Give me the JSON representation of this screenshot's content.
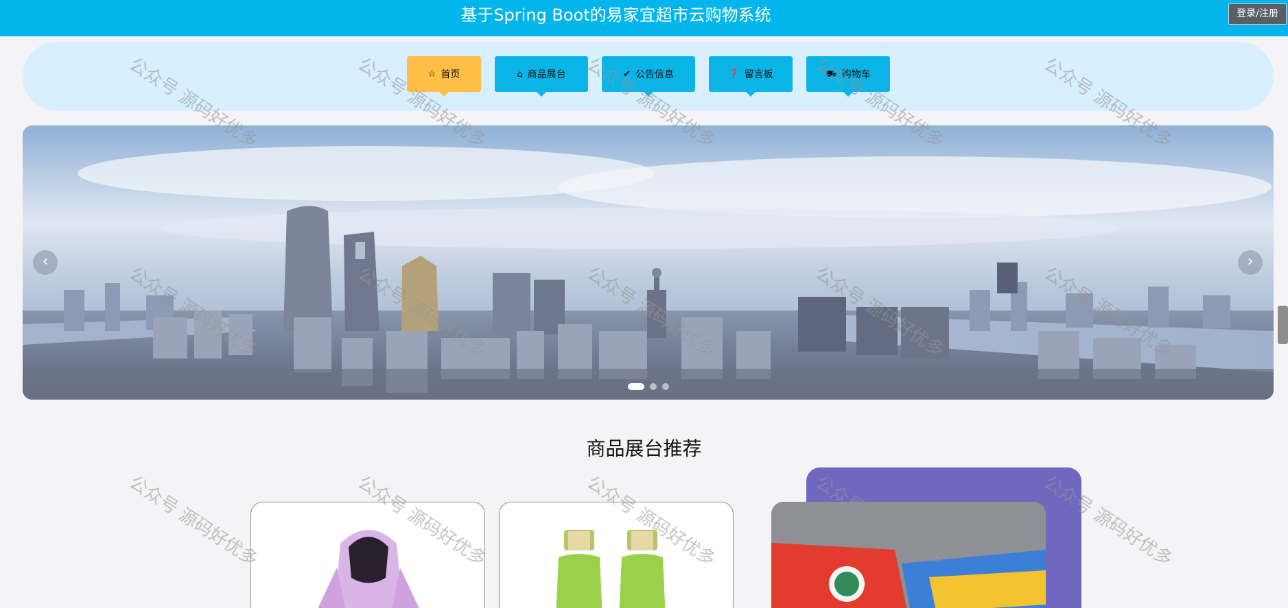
{
  "header": {
    "title": "基于Spring Boot的易家宜超市云购物系统",
    "login_label": "登录/注册"
  },
  "nav": {
    "items": [
      {
        "label": "首页",
        "icon": "star-icon",
        "glyph": "☆",
        "active": true
      },
      {
        "label": "商品展台",
        "icon": "shopping-bag-icon",
        "glyph": "⌂",
        "active": false
      },
      {
        "label": "公告信息",
        "icon": "bell-icon",
        "glyph": "✔",
        "active": false
      },
      {
        "label": "留言板",
        "icon": "question-icon",
        "glyph": "❓",
        "active": false
      },
      {
        "label": "购物车",
        "icon": "cart-icon",
        "glyph": "⛟",
        "active": false
      }
    ]
  },
  "carousel": {
    "prev_glyph": "‹",
    "next_glyph": "›",
    "dot_count": 3,
    "active_dot": 0
  },
  "section": {
    "title": "商品展台推荐"
  },
  "products": [
    {
      "image": "pink-hooded-jacket"
    },
    {
      "image": "green-cosmetic-bottles"
    },
    {
      "image": "snack-packets",
      "featured": true
    }
  ],
  "watermark": {
    "text": "公众号 源码好优多"
  },
  "colors": {
    "header_bg": "#02b5ea",
    "nav_bg": "#d7efff",
    "nav_item": "#0ab4e6",
    "nav_active": "#ffbe45",
    "feature_bg": "#7068bf"
  }
}
